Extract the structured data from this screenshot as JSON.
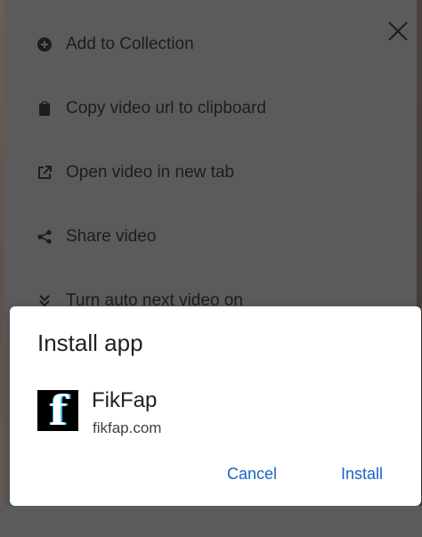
{
  "menu": {
    "items": [
      {
        "label": "Add to Collection",
        "icon": "add-circle-icon"
      },
      {
        "label": "Copy video url to clipboard",
        "icon": "clipboard-icon"
      },
      {
        "label": "Open video in new tab",
        "icon": "open-in-new-icon"
      },
      {
        "label": "Share video",
        "icon": "share-icon"
      },
      {
        "label": "Turn auto next video on",
        "icon": "double-chevron-down-icon"
      }
    ],
    "close_icon": "close-icon"
  },
  "install_dialog": {
    "title": "Install app",
    "app_name": "FikFap",
    "app_url": "fikfap.com",
    "logo_letter": "f",
    "cancel_label": "Cancel",
    "install_label": "Install",
    "accent_color": "#1a63c5"
  }
}
